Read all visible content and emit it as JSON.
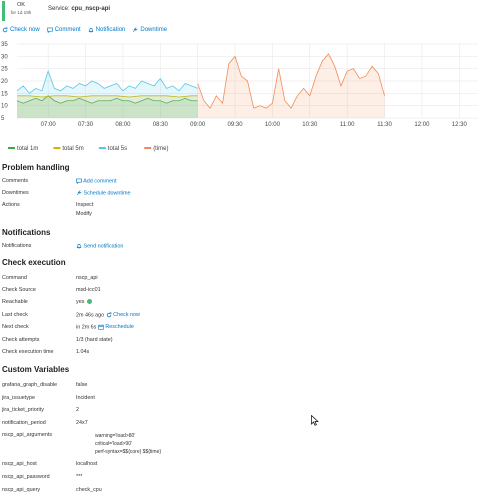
{
  "header": {
    "state": "OK",
    "since": "for 1d 19h",
    "service_label": "Service:",
    "service_name": "cpu_nscp-api"
  },
  "actions": {
    "check_now": "Check now",
    "comment": "Comment",
    "notification": "Notification",
    "downtime": "Downtime"
  },
  "chart_data": {
    "type": "line",
    "title": "",
    "xlabel": "",
    "ylabel": "",
    "ylim": [
      5,
      35
    ],
    "yticks": [
      "35",
      "30",
      "25",
      "20",
      "15",
      "10",
      "5"
    ],
    "xticks": [
      "07:00",
      "07:30",
      "08:00",
      "08:30",
      "09:00",
      "09:30",
      "10:00",
      "10:30",
      "11:00",
      "11:30",
      "12:00",
      "12:30"
    ],
    "grid": true,
    "legend_position": "bottom-left",
    "legend": [
      "total 1m",
      "total 5m",
      "total 5s",
      "(time)"
    ],
    "colors": {
      "total_1m": "#3fa64a",
      "total_5m": "#d9b200",
      "total_5s": "#54c8e8",
      "time": "#f08c5a"
    },
    "series": [
      {
        "name": "total 1m",
        "x": [
          "06:35",
          "06:40",
          "06:45",
          "06:50",
          "06:55",
          "07:00",
          "07:05",
          "07:10",
          "07:15",
          "07:20",
          "07:25",
          "07:30",
          "07:35",
          "07:40",
          "07:45",
          "07:50",
          "07:55",
          "08:00",
          "08:05",
          "08:10",
          "08:15",
          "08:20",
          "08:25",
          "08:30",
          "08:35",
          "08:40",
          "08:45",
          "08:50",
          "08:55",
          "09:00"
        ],
        "values": [
          12,
          11,
          12,
          13,
          12,
          14,
          12,
          11,
          12,
          12,
          13,
          12,
          11,
          12,
          12,
          12,
          13,
          12,
          12,
          11,
          12,
          13,
          12,
          12,
          11,
          12,
          12,
          13,
          12,
          12
        ]
      },
      {
        "name": "total 5m",
        "x": [
          "06:35",
          "06:45",
          "06:55",
          "07:05",
          "07:15",
          "07:25",
          "07:35",
          "07:45",
          "07:55",
          "08:05",
          "08:15",
          "08:25",
          "08:35",
          "08:45",
          "08:55",
          "09:00"
        ],
        "values": [
          14,
          14,
          13.5,
          14,
          14,
          13.5,
          14,
          14,
          14,
          13.5,
          14,
          14,
          14,
          13.5,
          14,
          14
        ]
      },
      {
        "name": "total 5s",
        "x": [
          "06:35",
          "06:40",
          "06:45",
          "06:50",
          "06:55",
          "07:00",
          "07:05",
          "07:10",
          "07:15",
          "07:20",
          "07:25",
          "07:30",
          "07:35",
          "07:40",
          "07:45",
          "07:50",
          "07:55",
          "08:00",
          "08:05",
          "08:10",
          "08:15",
          "08:20",
          "08:25",
          "08:30",
          "08:35",
          "08:40",
          "08:45",
          "08:50",
          "08:55",
          "09:00"
        ],
        "values": [
          16,
          18,
          15,
          17,
          16,
          24,
          17,
          16,
          18,
          17,
          19,
          18,
          20,
          19,
          17,
          18,
          19,
          16,
          18,
          17,
          20,
          19,
          18,
          21,
          17,
          18,
          16,
          19,
          18,
          17
        ]
      },
      {
        "name": "(time)",
        "x": [
          "09:00",
          "09:05",
          "09:10",
          "09:15",
          "09:20",
          "09:25",
          "09:30",
          "09:35",
          "09:40",
          "09:45",
          "09:50",
          "09:55",
          "10:00",
          "10:05",
          "10:10",
          "10:15",
          "10:20",
          "10:25",
          "10:30",
          "10:35",
          "10:40",
          "10:45",
          "10:50",
          "10:55",
          "11:00",
          "11:05",
          "11:10",
          "11:15",
          "11:20",
          "11:25",
          "11:30"
        ],
        "values": [
          19,
          12,
          9,
          14,
          11,
          27,
          30,
          22,
          20,
          9,
          10,
          9,
          11,
          25,
          12,
          9,
          14,
          17,
          14,
          22,
          28,
          31,
          26,
          18,
          24,
          25,
          21,
          22,
          26,
          23,
          14
        ]
      }
    ]
  },
  "problem_handling": {
    "title": "Problem handling",
    "comments_label": "Comments",
    "add_comment": "Add comment",
    "downtimes_label": "Downtimes",
    "schedule_downtime": "Schedule downtime",
    "actions_label": "Actions",
    "inspect": "Inspect",
    "modify": "Modify"
  },
  "notifications": {
    "title": "Notifications",
    "label": "Notifications",
    "send": "Send notification"
  },
  "check_execution": {
    "title": "Check execution",
    "command_label": "Command",
    "command": "nscp_api",
    "source_label": "Check Source",
    "source": "msd-icc01",
    "reachable_label": "Reachable",
    "reachable": "yes",
    "last_label": "Last check",
    "last": "2m 46s ago",
    "check_now": "Check now",
    "next_label": "Next check",
    "next": "in 2m 6s",
    "reschedule": "Reschedule",
    "attempts_label": "Check attempts",
    "attempts": "1/3 (hard state)",
    "exec_time_label": "Check execution time",
    "exec_time": "1.04s"
  },
  "custom_vars": {
    "title": "Custom Variables",
    "rows": [
      {
        "k": "grafana_graph_disable",
        "v": "false"
      },
      {
        "k": "jira_issuetype",
        "v": "Incident"
      },
      {
        "k": "jira_ticket_priority",
        "v": "2"
      },
      {
        "k": "notification_period",
        "v": "24x7"
      }
    ],
    "args_label": "nscp_api_arguments",
    "args": [
      "warning='load>80'",
      "critical='load>90'",
      "perf-syntax=$${core} $${time}"
    ],
    "rows2": [
      {
        "k": "nscp_api_host",
        "v": "localhost"
      },
      {
        "k": "nscp_api_password",
        "v": "***"
      },
      {
        "k": "nscp_api_query",
        "v": "check_cpu"
      }
    ]
  }
}
